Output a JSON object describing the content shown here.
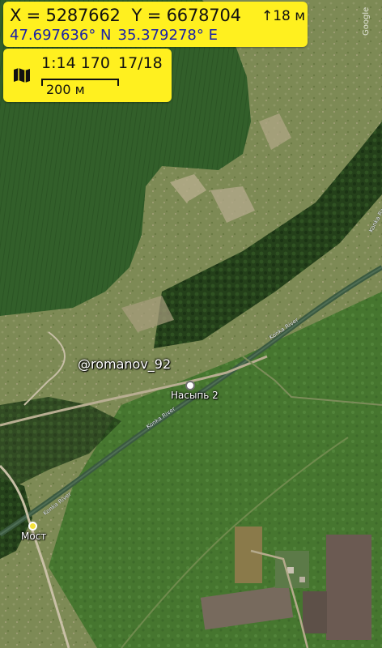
{
  "coordinates": {
    "x_label": "X = 5287662",
    "y_label": "Y = 6678704",
    "altitude": "↑18 м",
    "latitude": "47.697636° N",
    "longitude": "35.379278° E"
  },
  "scale": {
    "ratio": "1:14 170",
    "zoom": "17/18",
    "bar_label": "200 м"
  },
  "map_labels": {
    "user": "@romanov_92",
    "poi_nasyp": "Насыпь 2",
    "poi_most": "Мост",
    "river": "Konka River",
    "watermark": "Google"
  },
  "icons": {
    "map_mode": "map-icon",
    "poi_nasyp": "white-circle-marker",
    "poi_most": "yellow-circle-marker"
  },
  "colors": {
    "panel": "#fff01f",
    "latlon_text": "#1b22a8",
    "field": "#3c6a2b",
    "grass": "#7a8c53"
  }
}
